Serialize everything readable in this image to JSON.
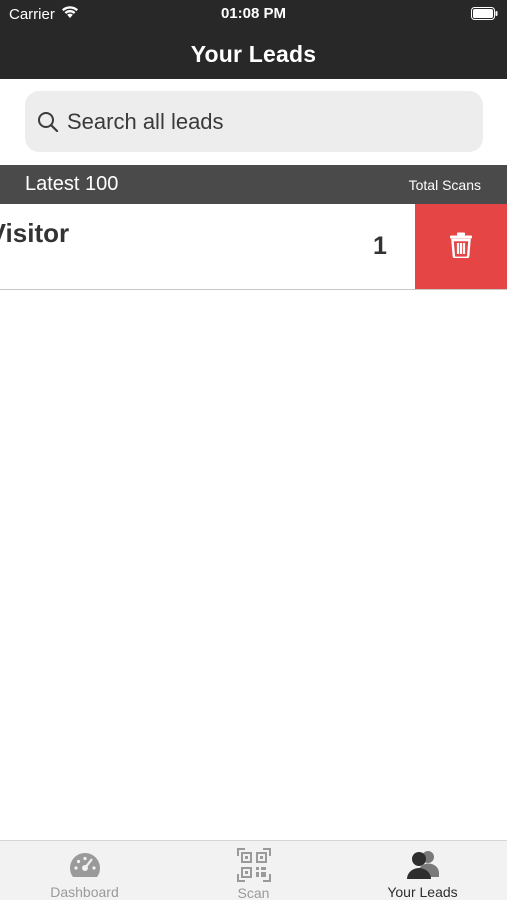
{
  "status_bar": {
    "carrier": "Carrier",
    "time": "01:08 PM"
  },
  "nav": {
    "title": "Your Leads"
  },
  "search": {
    "placeholder": "Search all leads"
  },
  "section": {
    "left_label": "Latest 100",
    "right_label": "Total Scans"
  },
  "leads": [
    {
      "name": "e Visitor",
      "count": "1"
    }
  ],
  "tabs": [
    {
      "label": "Dashboard",
      "icon": "dashboard-icon",
      "active": false
    },
    {
      "label": "Scan",
      "icon": "qr-code-icon",
      "active": false
    },
    {
      "label": "Your Leads",
      "icon": "people-icon",
      "active": true
    }
  ],
  "colors": {
    "bar": "#282828",
    "section_header": "#4a4a4a",
    "delete": "#e64545",
    "tab_active": "#2e2e2e",
    "tab_inactive": "#9a9a9a"
  }
}
